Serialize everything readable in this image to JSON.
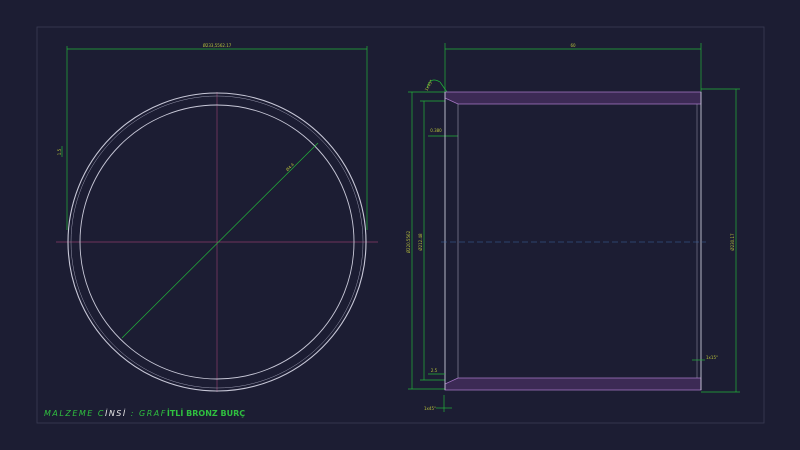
{
  "drawing": {
    "title_parts": [
      {
        "text": "MALZEME C",
        "style": "green"
      },
      {
        "text": "İNSİ",
        "style": "white"
      },
      {
        "text": " : GRAF",
        "style": "green"
      },
      {
        "text": "İTLİ BRONZ BURÇ",
        "style": "bold"
      }
    ],
    "colors": {
      "background": "#1c1d33",
      "frame": "#3a3c55",
      "outline": "#c8c8d8",
      "dimension": "#22b33a",
      "dim_text": "#b9c23a",
      "center_line": "#8a3d6a",
      "wall_fill": "#3c2a55"
    }
  },
  "front_view": {
    "dim_top": "Ø233,5562.17",
    "dim_radius": "Ø4.4",
    "dim_left": "1.5"
  },
  "side_view": {
    "dim_top": "60",
    "dim_chamfer_top": "1x45°",
    "dim_offset": "0.380",
    "dim_left_outer": "Ø220.5562",
    "dim_left_inner": "Ø212.48",
    "dim_right": "Ø230.17",
    "dim_chamfer_br": "1x15°",
    "dim_bottom_small": "2.5",
    "dim_chamfer_bottom": "1x45°"
  }
}
